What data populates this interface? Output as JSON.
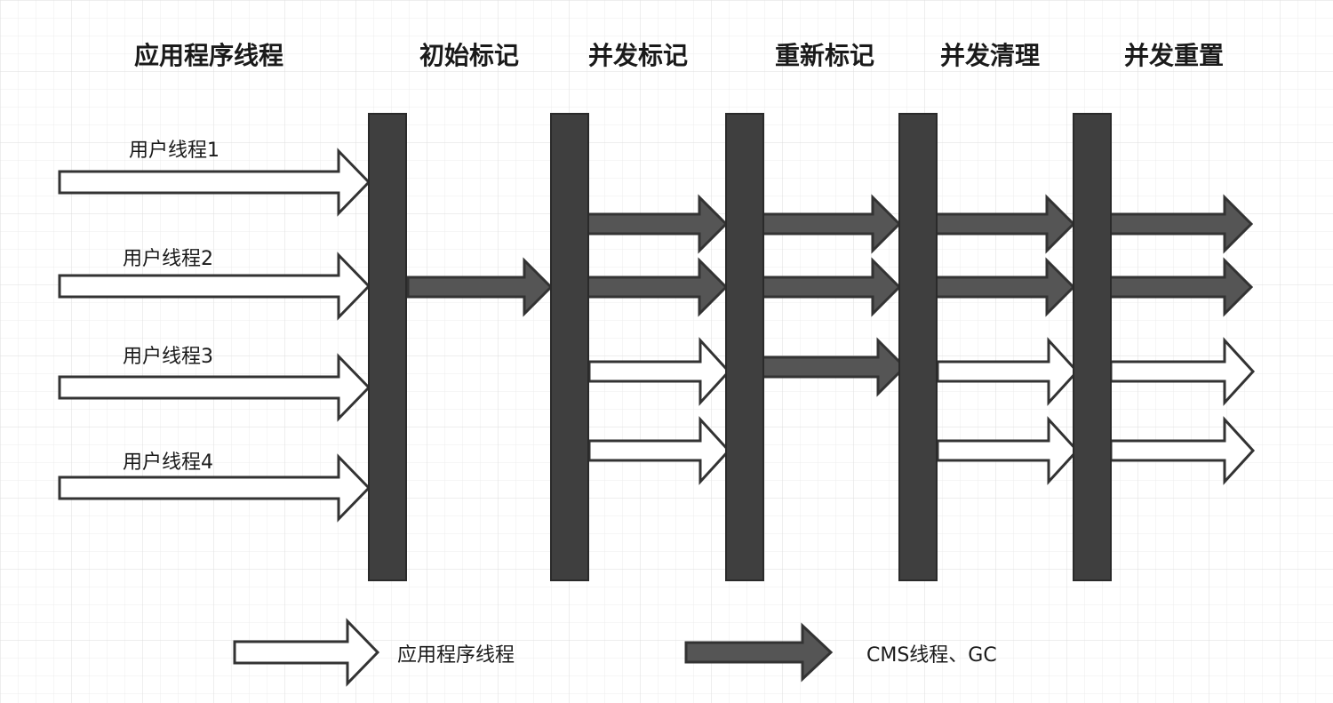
{
  "headers": {
    "app_threads": "应用程序线程",
    "initial_mark": "初始标记",
    "concurrent_mark": "并发标记",
    "remark": "重新标记",
    "concurrent_sweep": "并发清理",
    "concurrent_reset": "并发重置"
  },
  "threads": [
    "用户线程1",
    "用户线程2",
    "用户线程3",
    "用户线程4"
  ],
  "legend": {
    "app_thread": "应用程序线程",
    "cms_thread": "CMS线程、GC"
  },
  "colors": {
    "bar": "#3f3f3f",
    "gc_arrow": "#555555",
    "app_arrow_fill": "#ffffff",
    "stroke": "#333333",
    "grid": "#e6e6e6"
  }
}
